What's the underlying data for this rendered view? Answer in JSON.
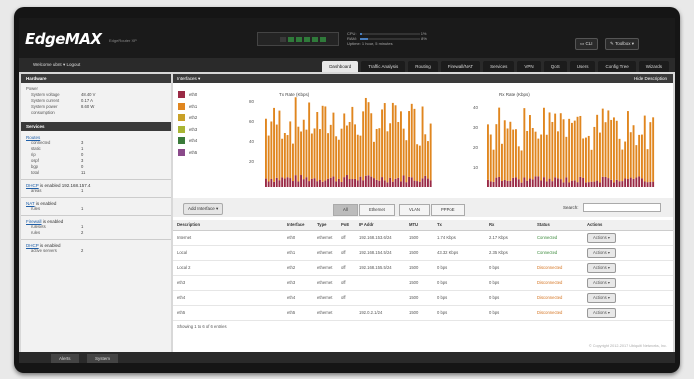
{
  "app": {
    "logo": "EdgeMAX",
    "model": "EdgeRouter XP"
  },
  "system_stats": {
    "cpu_label": "CPU:",
    "cpu_value": "1%",
    "ram_label": "RAM:",
    "ram_value": "8%",
    "uptime_label": "Uptime:",
    "uptime_value": "1 hour, 5 minutes"
  },
  "top_buttons": {
    "cli": "CLI",
    "toolbox": "Toolbox"
  },
  "welcome": {
    "text": "Welcome ubnt",
    "logout": "Logout"
  },
  "tabs": [
    "Dashboard",
    "Traffic Analysis",
    "Routing",
    "Firewall/NAT",
    "Services",
    "VPN",
    "QoS",
    "Users",
    "Config Tree",
    "Wizards"
  ],
  "hardware": {
    "title": "Hardware",
    "items": [
      {
        "k": "Power",
        "v": ""
      },
      {
        "k": "System voltage",
        "v": "48.40 V"
      },
      {
        "k": "System current",
        "v": "0.17 A"
      },
      {
        "k": "System power",
        "v": "8.60 W"
      },
      {
        "k": "consumption",
        "v": ""
      }
    ]
  },
  "services": {
    "title": "Services",
    "routes_label": "Routes",
    "routes": [
      {
        "k": "connected",
        "v": "3"
      },
      {
        "k": "static",
        "v": "1"
      },
      {
        "k": "rip",
        "v": "0"
      },
      {
        "k": "ospf",
        "v": "3"
      },
      {
        "k": "bgp",
        "v": "0"
      },
      {
        "k": "total",
        "v": "11"
      }
    ],
    "dhcp_label": "DHCP",
    "dhcp_status": "is enabled",
    "dhcp_ip": "192.168.157.4",
    "dhcp_kv": {
      "k": "areas",
      "v": "1"
    },
    "nat_label": "NAT",
    "nat_status": "is enabled",
    "nat_kv": {
      "k": "rules",
      "v": "1"
    },
    "firewall_label": "Firewall",
    "firewall_status": "is enabled",
    "firewall_kv": [
      {
        "k": "rulesets",
        "v": "1"
      },
      {
        "k": "rules",
        "v": "2"
      }
    ],
    "dhcp2_label": "DHCP",
    "dhcp2_status": "is enabled",
    "dhcp2_kv": {
      "k": "active servers",
      "v": "2"
    }
  },
  "interfaces": {
    "title": "Interfaces",
    "hide_label": "Hide Description",
    "legend": [
      {
        "name": "eth0",
        "color": "#9a2a45"
      },
      {
        "name": "eth1",
        "color": "#e0861f"
      },
      {
        "name": "eth2",
        "color": "#c9a128"
      },
      {
        "name": "eth3",
        "color": "#a9b534"
      },
      {
        "name": "eth4",
        "color": "#3a7a3a"
      },
      {
        "name": "eth5",
        "color": "#8a4a8a"
      }
    ],
    "tx_title": "Tx Rate (Kbps)",
    "rx_title": "Rx Rate (Kbps)",
    "tx_ticks": [
      "80",
      "60",
      "40",
      "20"
    ],
    "rx_ticks": [
      "40",
      "30",
      "20",
      "10"
    ],
    "add_interface": "Add Interface",
    "filters": [
      "All",
      "Ethernet",
      "VLAN",
      "PPPoE"
    ],
    "search_label": "Search:",
    "columns": [
      "Description",
      "Interface",
      "Type",
      "PoE",
      "IP Addr",
      "MTU",
      "Tx",
      "Rx",
      "Status",
      "Actions"
    ],
    "rows": [
      {
        "desc": "Internet",
        "iface": "eth0",
        "type": "ethernet",
        "poe": "off",
        "ip": "192.168.153.6/24",
        "mtu": "1500",
        "tx": "1.74 Kbps",
        "rx": "2.17 Kbps",
        "status": "Connected",
        "action": "Actions"
      },
      {
        "desc": "Local",
        "iface": "eth1",
        "type": "ethernet",
        "poe": "off",
        "ip": "192.168.154.5/24",
        "mtu": "1500",
        "tx": "43.32 Kbps",
        "rx": "2.35 Kbps",
        "status": "Connected",
        "action": "Actions"
      },
      {
        "desc": "Local 2",
        "iface": "eth2",
        "type": "ethernet",
        "poe": "off",
        "ip": "192.168.155.5/24",
        "mtu": "1500",
        "tx": "0 bps",
        "rx": "0 bps",
        "status": "Disconnected",
        "action": "Actions"
      },
      {
        "desc": "eth3",
        "iface": "eth3",
        "type": "ethernet",
        "poe": "off",
        "ip": "",
        "mtu": "1500",
        "tx": "0 bps",
        "rx": "0 bps",
        "status": "Disconnected",
        "action": "Actions"
      },
      {
        "desc": "eth4",
        "iface": "eth4",
        "type": "ethernet",
        "poe": "off",
        "ip": "",
        "mtu": "1500",
        "tx": "0 bps",
        "rx": "0 bps",
        "status": "Disconnected",
        "action": "Actions"
      },
      {
        "desc": "eth5",
        "iface": "eth5",
        "type": "ethernet",
        "poe": "",
        "ip": "192.0.2.1/24",
        "mtu": "1500",
        "tx": "0 bps",
        "rx": "0 bps",
        "status": "Disconnected",
        "action": "Actions"
      }
    ],
    "showing": "Showing 1 to 6 of 6 entries"
  },
  "footer": {
    "alerts": "Alerts",
    "system": "System",
    "copyright": "© Copyright 2012-2017 Ubiquiti Networks, Inc."
  }
}
